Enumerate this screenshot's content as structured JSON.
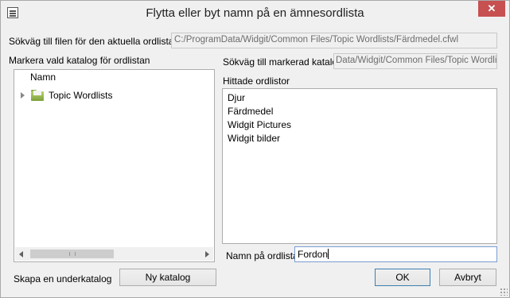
{
  "window": {
    "title": "Flytta eller byt namn på en ämnesordlista",
    "close_label": "✕"
  },
  "current_path": {
    "label": "Sökväg till filen för den aktuella ordlistan",
    "value": "C:/ProgramData/Widgit/Common Files/Topic Wordlists/Färdmedel.cfwl"
  },
  "folder_tree": {
    "label": "Markera vald katalog för ordlistan",
    "column_header": "Namn",
    "nodes": [
      {
        "label": "Topic Wordlists",
        "icon": "folder-icon",
        "expanded": false
      }
    ]
  },
  "selected_path": {
    "label": "Sökväg till markerad katalog",
    "value": "Data/Widgit/Common Files/Topic Wordlists"
  },
  "found_lists": {
    "label": "Hittade ordlistor",
    "items": [
      "Djur",
      "Färdmedel",
      "Widgit Pictures",
      "Widgit bilder"
    ]
  },
  "list_name": {
    "label": "Namn på ordlistan",
    "value": "Fordon"
  },
  "subfolder": {
    "label": "Skapa en underkatalog",
    "button_label": "Ny katalog"
  },
  "actions": {
    "ok_label": "OK",
    "cancel_label": "Avbryt"
  },
  "colors": {
    "close_button": "#c75050",
    "default_button_border": "#3c7fb1"
  }
}
